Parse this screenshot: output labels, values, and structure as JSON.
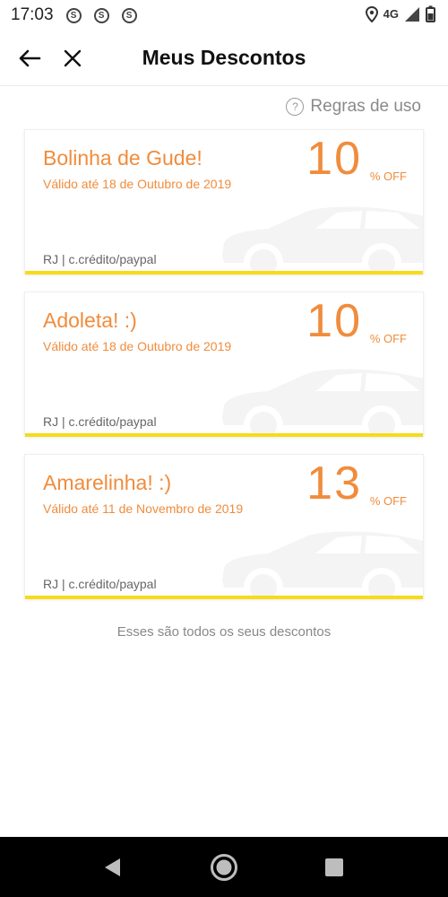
{
  "status": {
    "time": "17:03",
    "network": "4G",
    "notif_glyph": "S"
  },
  "header": {
    "title": "Meus Descontos",
    "back_icon": "arrow-left-icon",
    "close_icon": "close-icon"
  },
  "rules": {
    "icon_glyph": "?",
    "label": "Regras de uso"
  },
  "coupons": [
    {
      "title": "Bolinha de Gude!",
      "valid": "Válido até 18 de Outubro de 2019",
      "amount": "10",
      "off": "% OFF",
      "footer": "RJ | c.crédito/paypal"
    },
    {
      "title": "Adoleta! :)",
      "valid": "Válido até 18 de Outubro de 2019",
      "amount": "10",
      "off": "% OFF",
      "footer": "RJ | c.crédito/paypal"
    },
    {
      "title": "Amarelinha! :)",
      "valid": "Válido até 11 de Novembro de 2019",
      "amount": "13",
      "off": "% OFF",
      "footer": "RJ | c.crédito/paypal"
    }
  ],
  "end_note": "Esses são todos os seus descontos",
  "colors": {
    "accent": "#f08c3c",
    "bar": "#f5dc1a"
  },
  "nav": {
    "back_icon": "triangle-back-icon",
    "home_icon": "home-circle-icon",
    "recents_icon": "square-recents-icon"
  }
}
